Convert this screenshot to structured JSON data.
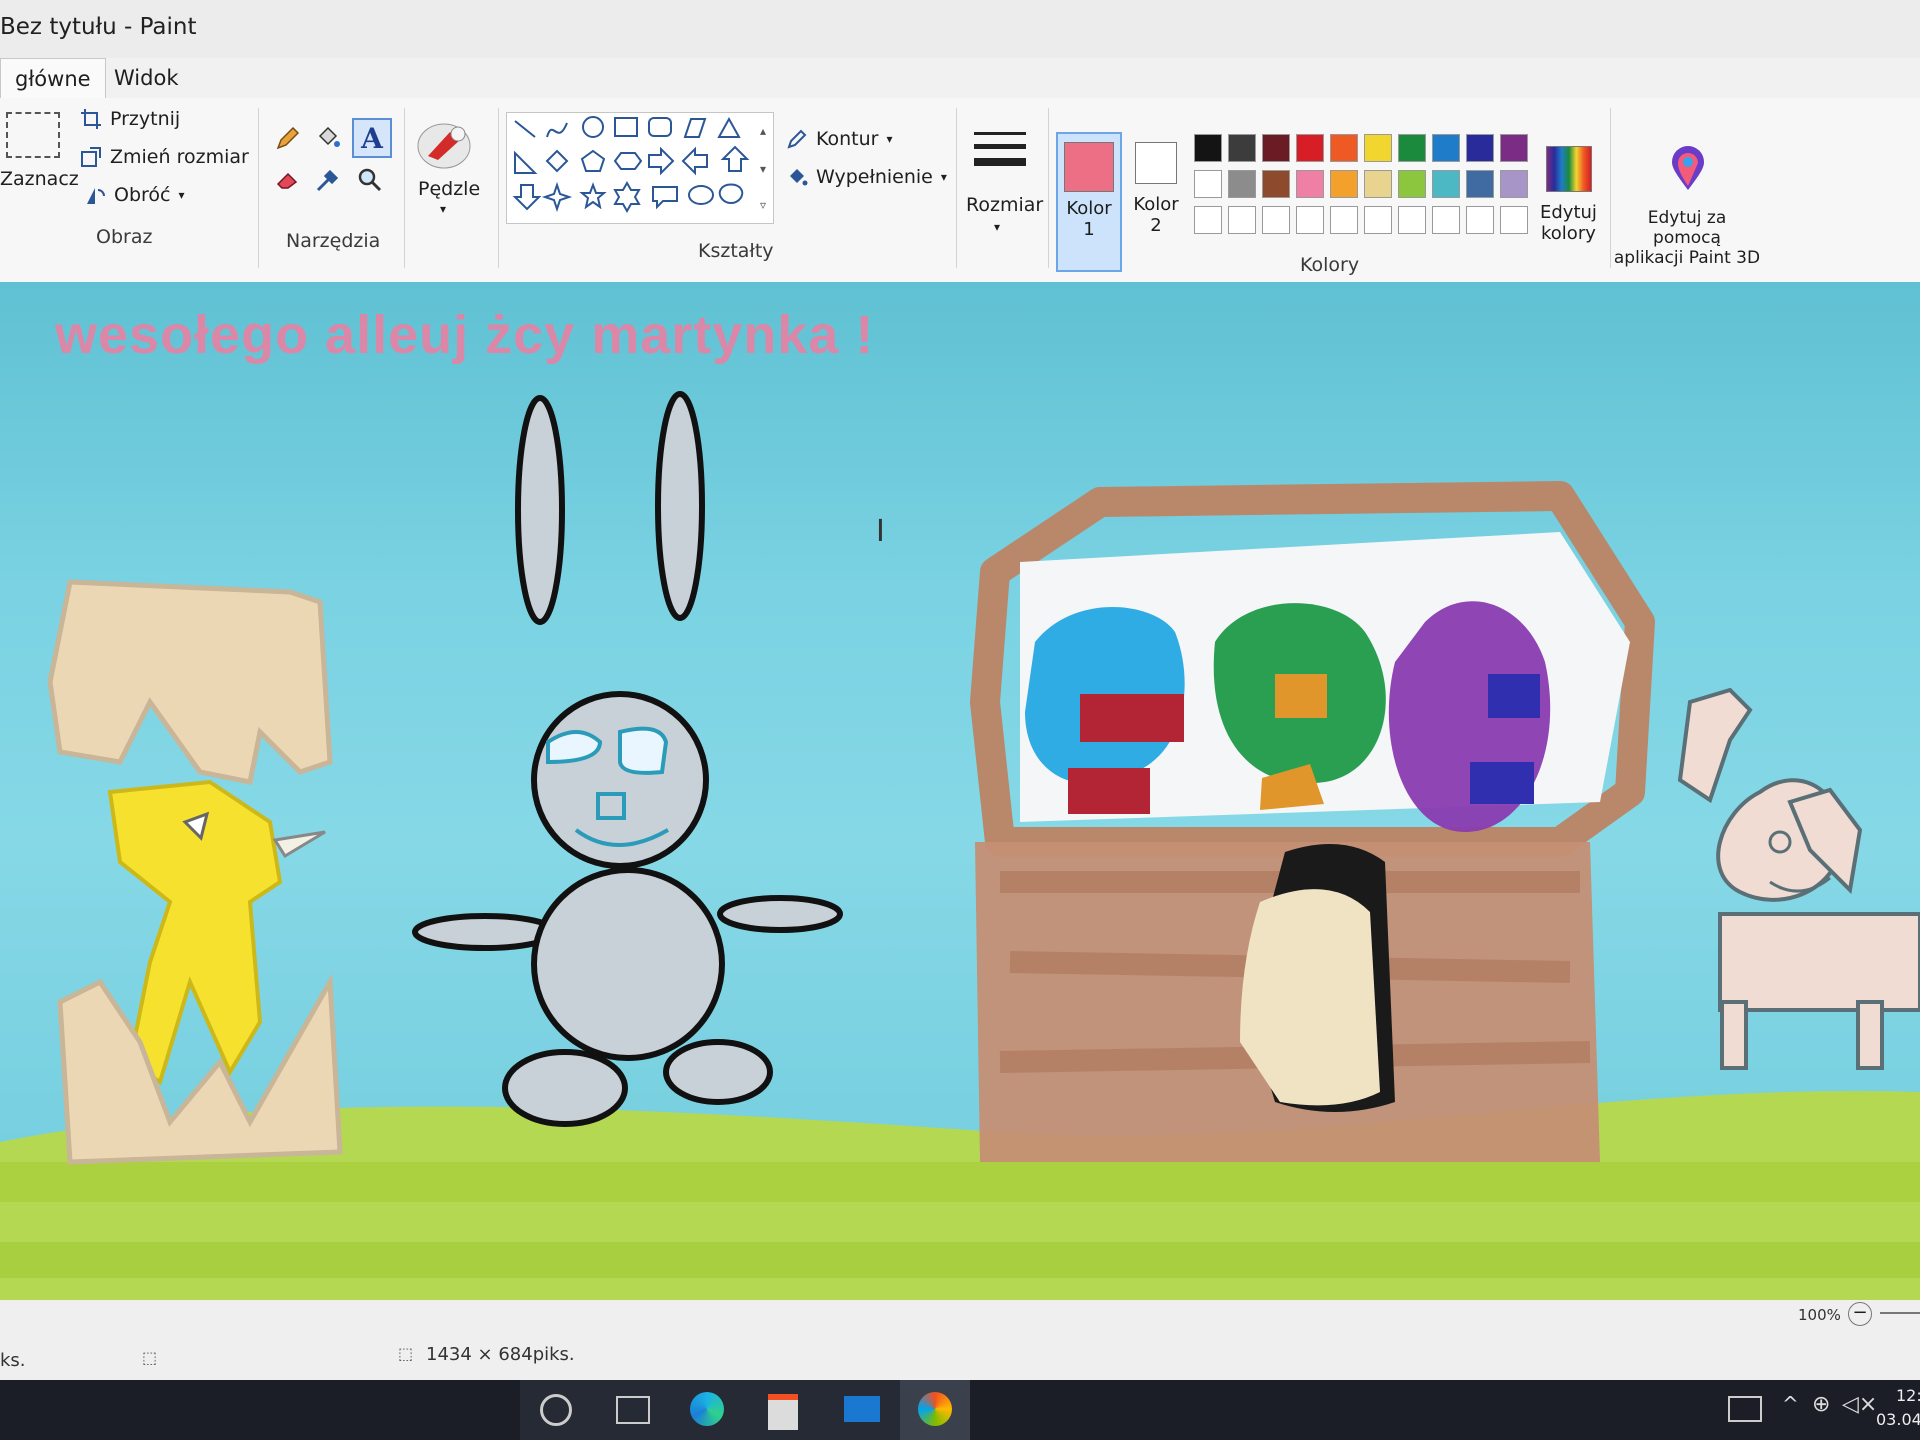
{
  "window": {
    "title": "Bez tytułu - Paint"
  },
  "tabs": [
    {
      "label": "główne"
    },
    {
      "label": "Widok"
    }
  ],
  "ribbon": {
    "obraz": {
      "label": "Obraz",
      "select_label": "Zaznacz",
      "crop_label": "Przytnij",
      "resize_label": "Zmień rozmiar",
      "rotate_label": "Obróć"
    },
    "tools": {
      "label": "Narzędzia"
    },
    "brushes": {
      "label": "Pędzle"
    },
    "shapes": {
      "label": "Kształty",
      "outline_label": "Kontur",
      "fill_label": "Wypełnienie"
    },
    "size": {
      "label": "Rozmiar"
    },
    "colors": {
      "label": "Kolory",
      "color1_label": "Kolor\n1",
      "color2_label": "Kolor\n2",
      "color1": "#ec6f86",
      "color2": "#ffffff",
      "edit_colors_label": "Edytuj\nkolory",
      "palette_row1": [
        "#141414",
        "#3c3c3c",
        "#6a1b23",
        "#d71d25",
        "#ee5a24",
        "#f2d630",
        "#1c8a3c",
        "#1e7cc8",
        "#2a2b9a",
        "#7b2c84"
      ],
      "palette_row2": [
        "#ffffff",
        "#8c8c8c",
        "#8d4a2c",
        "#f07fa5",
        "#f3a02c",
        "#e8d48e",
        "#8cc63f",
        "#4cb8c4",
        "#3f6aa2",
        "#a895c8"
      ]
    },
    "paint3d": {
      "label": "Edytuj za pomocą\naplikacji Paint 3D"
    }
  },
  "canvas": {
    "greeting_text": "wesołego alleuj żcy martynka !"
  },
  "statusbar": {
    "left_text": "ks.",
    "canvas_size": "1434 × 684piks.",
    "zoom": "100%",
    "clock_time": "12:",
    "clock_date": "03.04."
  }
}
